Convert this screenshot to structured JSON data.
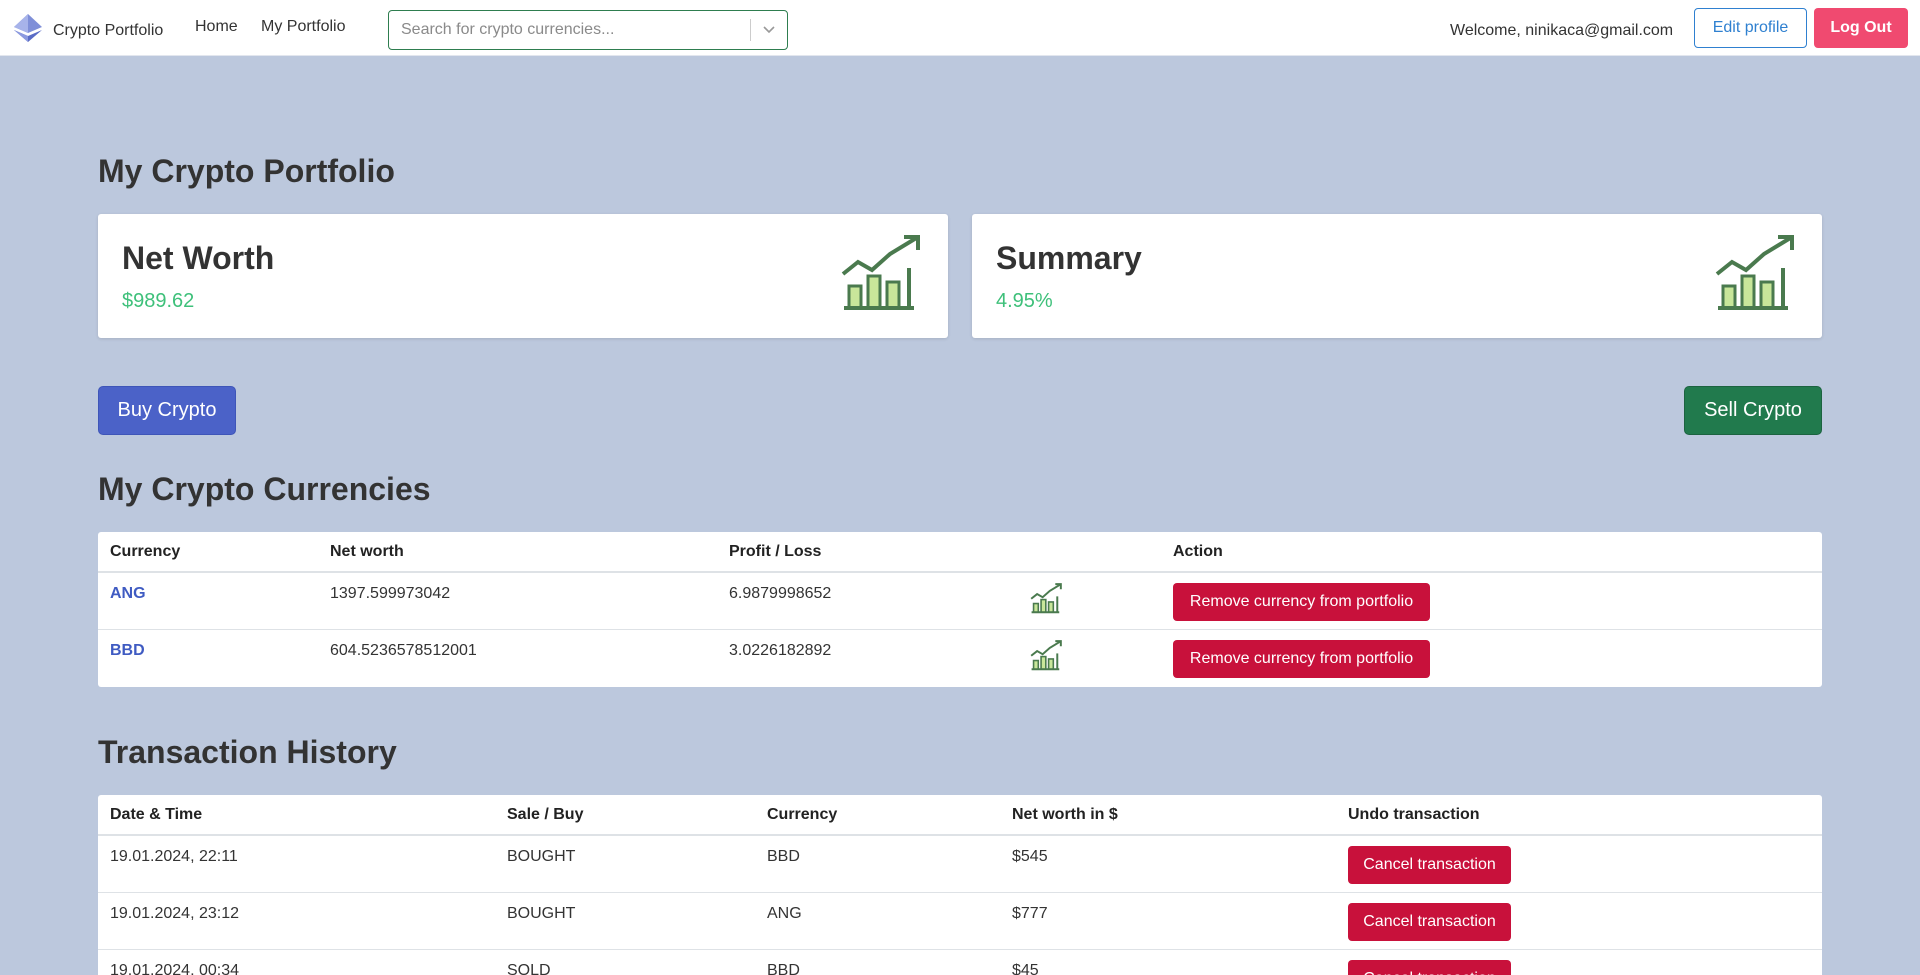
{
  "navbar": {
    "brand": "Crypto Portfolio",
    "links": [
      "Home",
      "My Portfolio"
    ],
    "search_placeholder": "Search for crypto currencies...",
    "welcome": "Welcome, ninikaca@gmail.com",
    "edit_profile": "Edit profile",
    "logout": "Log Out"
  },
  "page_title": "My Crypto Portfolio",
  "cards": {
    "net_worth": {
      "title": "Net Worth",
      "value": "$989.62"
    },
    "summary": {
      "title": "Summary",
      "value": "4.95%"
    }
  },
  "actions": {
    "buy": "Buy Crypto",
    "sell": "Sell Crypto"
  },
  "currencies": {
    "title": "My Crypto Currencies",
    "headers": [
      "Currency",
      "Net worth",
      "Profit / Loss",
      "Action"
    ],
    "rows": [
      {
        "currency": "ANG",
        "net_worth": "1397.599973042",
        "profit_loss": "6.9879998652",
        "action": "Remove currency from portfolio"
      },
      {
        "currency": "BBD",
        "net_worth": "604.5236578512001",
        "profit_loss": "3.0226182892",
        "action": "Remove currency from portfolio"
      }
    ]
  },
  "transactions": {
    "title": "Transaction History",
    "headers": [
      "Date & Time",
      "Sale / Buy",
      "Currency",
      "Net worth in $",
      "Undo transaction"
    ],
    "rows": [
      {
        "datetime": "19.01.2024, 22:11",
        "type": "BOUGHT",
        "currency": "BBD",
        "net_worth": "$545",
        "undo": "Cancel transaction"
      },
      {
        "datetime": "19.01.2024, 23:12",
        "type": "BOUGHT",
        "currency": "ANG",
        "net_worth": "$777",
        "undo": "Cancel transaction"
      },
      {
        "datetime": "19.01.2024, 00:34",
        "type": "SOLD",
        "currency": "BBD",
        "net_worth": "$45",
        "undo": "Cancel transaction"
      }
    ]
  },
  "colors": {
    "background": "#bcc8dd",
    "positive": "#3ec07a",
    "buy": "#4b62c8",
    "sell": "#217a4d",
    "danger": "#c8113b",
    "logout": "#f04a70",
    "link": "#3f5bc2"
  },
  "icons": {
    "brand": "ethereum-logo-icon",
    "growth": "growth-chart-icon",
    "dropdown": "chevron-down-icon"
  }
}
